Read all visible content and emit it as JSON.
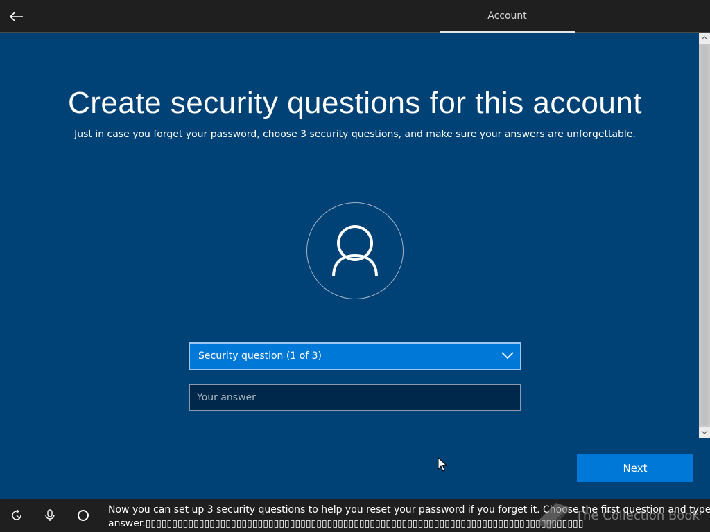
{
  "header": {
    "tab_label": "Account"
  },
  "main": {
    "title": "Create security questions for this account",
    "subtitle": "Just in case you forget your password, choose 3 security questions, and make sure your answers are unforgettable.",
    "question_select": {
      "selected": "Security question (1 of 3)"
    },
    "answer_input": {
      "placeholder": "Your answer",
      "value": ""
    },
    "next_label": "Next"
  },
  "taskbar": {
    "narration_line1": "Now you can set up 3 security questions to help you reset your password if you forget it. Choose the first question and type",
    "narration_line2": "answer.▯▯▯▯▯▯▯▯▯▯▯▯▯▯▯▯▯▯▯▯▯▯▯▯▯▯▯▯▯▯▯▯▯▯▯▯▯▯▯▯▯▯▯▯▯▯▯▯▯▯▯▯▯▯▯▯▯▯▯▯▯▯▯▯▯▯▯▯▯▯▯▯▯▯▯▯▯▯▯▯▯▯",
    "watermark_text": "The Collection Book"
  },
  "colors": {
    "background": "#004275",
    "accent": "#0078d7",
    "topbar": "#1f1f1f"
  },
  "icons": [
    "back-arrow-icon",
    "user-icon",
    "chevron-down-icon",
    "accessibility-icon",
    "microphone-icon",
    "cortana-icon",
    "mouse-cursor-icon"
  ]
}
